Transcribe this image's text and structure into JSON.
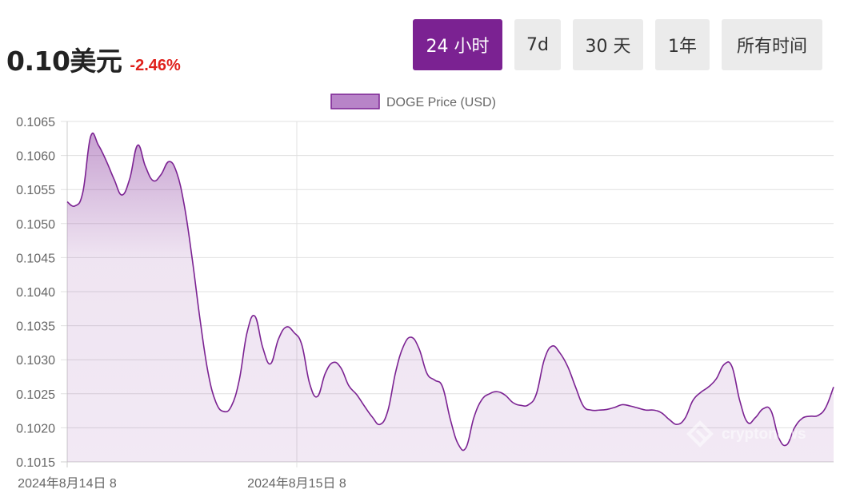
{
  "header": {
    "price": "0.10美元",
    "change": "-2.46%"
  },
  "range_tabs": [
    {
      "label": "24 小时",
      "active": true
    },
    {
      "label": "7d",
      "active": false
    },
    {
      "label": "30 天",
      "active": false
    },
    {
      "label": "1年",
      "active": false
    },
    {
      "label": "所有时间",
      "active": false
    }
  ],
  "colors": {
    "accent": "#7b2292",
    "negative": "#e0201b",
    "tab_bg": "#ebebeb",
    "line": "#7b2292",
    "legend_fill": "#b884c8",
    "grid": "#e0e0e0"
  },
  "watermark": "cryptonews",
  "chart_data": {
    "type": "area",
    "legend": {
      "label": "DOGE Price (USD)",
      "position": "top-center"
    },
    "x_tick_labels": [
      "2024年8月14日 8",
      "2024年8月15日 8"
    ],
    "y_tick_labels": [
      "0.1065",
      "0.1060",
      "0.1055",
      "0.1050",
      "0.1045",
      "0.1040",
      "0.1035",
      "0.1030",
      "0.1025",
      "0.1020",
      "0.1015"
    ],
    "ylim": [
      0.1015,
      0.1065
    ],
    "grid": true,
    "series": [
      {
        "name": "DOGE Price (USD)",
        "values": [
          0.10532,
          0.10526,
          0.10546,
          0.10628,
          0.10615,
          0.10592,
          0.10565,
          0.10542,
          0.10566,
          0.10615,
          0.10584,
          0.10563,
          0.10572,
          0.10591,
          0.10575,
          0.10525,
          0.10447,
          0.10358,
          0.10282,
          0.10238,
          0.10224,
          0.10232,
          0.1027,
          0.1034,
          0.10364,
          0.10318,
          0.10294,
          0.1033,
          0.10348,
          0.1034,
          0.10322,
          0.10265,
          0.10246,
          0.1028,
          0.10296,
          0.10288,
          0.10262,
          0.10249,
          0.10232,
          0.10216,
          0.10205,
          0.10225,
          0.10282,
          0.1032,
          0.10333,
          0.10316,
          0.1028,
          0.1027,
          0.1026,
          0.10212,
          0.10176,
          0.10171,
          0.10215,
          0.10241,
          0.1025,
          0.10253,
          0.10248,
          0.10237,
          0.10233,
          0.10234,
          0.1025,
          0.103,
          0.1032,
          0.1031,
          0.1029,
          0.1026,
          0.10232,
          0.10226,
          0.10226,
          0.10227,
          0.1023,
          0.10234,
          0.10232,
          0.10229,
          0.10226,
          0.10226,
          0.10222,
          0.10212,
          0.10205,
          0.10214,
          0.1024,
          0.10252,
          0.1026,
          0.10272,
          0.10293,
          0.1029,
          0.1024,
          0.10208,
          0.10215,
          0.10228,
          0.10225,
          0.10185,
          0.10175,
          0.102,
          0.10214,
          0.10217,
          0.10218,
          0.1023,
          0.1026
        ]
      }
    ]
  }
}
